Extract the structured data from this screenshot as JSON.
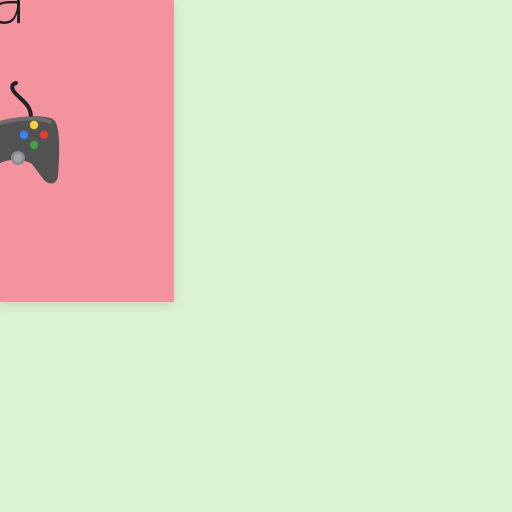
{
  "page": {
    "background_color": "#dcf3d1"
  },
  "card": {
    "background_color": "#f2939d",
    "text": "a",
    "icon": "video-game-controller-icon"
  }
}
